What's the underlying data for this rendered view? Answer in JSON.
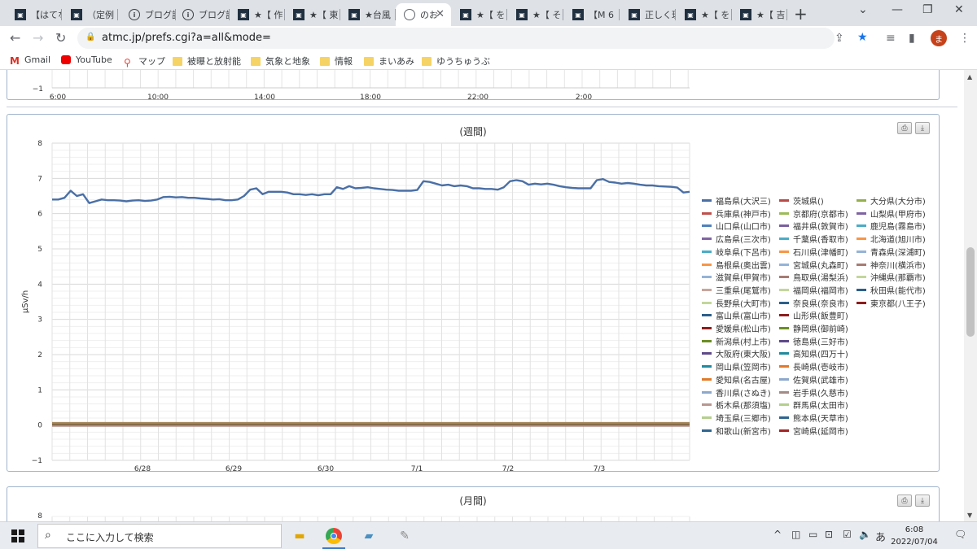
{
  "browser": {
    "tabs": [
      {
        "label": "【はてな",
        "icon": "dark-square-icon"
      },
      {
        "label": "（定例",
        "icon": "dark-square-icon"
      },
      {
        "label": "ブログ記",
        "icon": "info-icon"
      },
      {
        "label": "ブログ記",
        "icon": "info-icon"
      },
      {
        "label": "★【 作",
        "icon": "dark-square-icon"
      },
      {
        "label": "★【 東",
        "icon": "dark-square-icon"
      },
      {
        "label": "★台風",
        "icon": "dark-square-icon"
      },
      {
        "label": "のお",
        "icon": "globe-icon",
        "active": true
      },
      {
        "label": "★【 を",
        "icon": "dark-square-icon"
      },
      {
        "label": "★【 そ",
        "icon": "dark-square-icon"
      },
      {
        "label": "【M 6",
        "icon": "dark-square-icon"
      },
      {
        "label": "正しく理",
        "icon": "dark-square-icon"
      },
      {
        "label": "★【 を",
        "icon": "dark-square-icon"
      },
      {
        "label": "★【 吉",
        "icon": "dark-square-icon"
      }
    ],
    "url": "atmc.jp/prefs.cgi?a=all&mode=",
    "profile_initial": "ま",
    "bookmarks": [
      {
        "label": "Gmail",
        "icon": "gmail-icon"
      },
      {
        "label": "YouTube",
        "icon": "youtube-icon"
      },
      {
        "label": "マップ",
        "icon": "maps-icon"
      },
      {
        "label": "被曝と放射能",
        "icon": "folder-icon"
      },
      {
        "label": "気象と地象",
        "icon": "folder-icon"
      },
      {
        "label": "情報",
        "icon": "folder-icon"
      },
      {
        "label": "まいあみ",
        "icon": "folder-icon"
      },
      {
        "label": "ゆうちゅうぶ",
        "icon": "folder-icon"
      }
    ]
  },
  "top_chart": {
    "x_ticks": [
      "6:00",
      "10:00",
      "14:00",
      "18:00",
      "22:00",
      "2:00"
    ],
    "y_min_label": "−1"
  },
  "chart_data": [
    {
      "type": "line",
      "title": "(週間)",
      "ylabel": "μSv/h",
      "ylim": [
        -1,
        8
      ],
      "y_ticks": [
        "8",
        "7",
        "6",
        "5",
        "4",
        "3",
        "2",
        "1",
        "0",
        "−1"
      ],
      "x_ticks": [
        "6/28",
        "6/29",
        "6/30",
        "7/1",
        "7/2",
        "7/3"
      ],
      "grid": true,
      "legend_position": "right",
      "series": [
        {
          "name": "福島県(大沢三)",
          "color": "#4a6fa5",
          "values": [
            6.4,
            6.4,
            6.45,
            6.65,
            6.5,
            6.55,
            6.3,
            6.35,
            6.4,
            6.38,
            6.38,
            6.37,
            6.35,
            6.37,
            6.38,
            6.36,
            6.37,
            6.4,
            6.47,
            6.48,
            6.46,
            6.47,
            6.45,
            6.45,
            6.43,
            6.42,
            6.4,
            6.41,
            6.38,
            6.38,
            6.4,
            6.5,
            6.68,
            6.72,
            6.55,
            6.62,
            6.62,
            6.62,
            6.6,
            6.55,
            6.55,
            6.53,
            6.55,
            6.52,
            6.55,
            6.55,
            6.75,
            6.7,
            6.78,
            6.72,
            6.73,
            6.75,
            6.72,
            6.7,
            6.68,
            6.67,
            6.65,
            6.65,
            6.65,
            6.67,
            6.92,
            6.9,
            6.85,
            6.8,
            6.82,
            6.78,
            6.8,
            6.78,
            6.72,
            6.72,
            6.7,
            6.7,
            6.68,
            6.75,
            6.92,
            6.95,
            6.92,
            6.82,
            6.85,
            6.83,
            6.85,
            6.82,
            6.78,
            6.75,
            6.73,
            6.72,
            6.72,
            6.72,
            6.95,
            6.98,
            6.9,
            6.88,
            6.85,
            6.87,
            6.85,
            6.82,
            6.8,
            6.8,
            6.78,
            6.77,
            6.76,
            6.74,
            6.6,
            6.62
          ]
        },
        {
          "name": "茨城県()",
          "color": "#b94a48",
          "values": []
        },
        {
          "name": "大分県(大分市)",
          "color": "#93b04a",
          "values": []
        },
        {
          "name": "兵庫県(神戸市)",
          "color": "#c0504d",
          "values": []
        },
        {
          "name": "京都府(京都市)",
          "color": "#9bbb59",
          "values": []
        },
        {
          "name": "山梨県(甲府市)",
          "color": "#8064a2",
          "values": []
        },
        {
          "name": "山口県(山口市)",
          "color": "#4f81bd",
          "values": []
        },
        {
          "name": "福井県(敦賀市)",
          "color": "#7b5fa0",
          "values": []
        },
        {
          "name": "鹿児島(霧島市)",
          "color": "#4bacc6",
          "values": []
        },
        {
          "name": "広島県(三次市)",
          "color": "#8064a2",
          "values": []
        },
        {
          "name": "千葉県(香取市)",
          "color": "#4bacc6",
          "values": []
        },
        {
          "name": "北海道(旭川市)",
          "color": "#f79646",
          "values": []
        },
        {
          "name": "岐阜県(下呂市)",
          "color": "#4bacc6",
          "values": []
        },
        {
          "name": "石川県(津幡町)",
          "color": "#f79646",
          "values": []
        },
        {
          "name": "青森県(深浦町)",
          "color": "#95b3d7",
          "values": []
        },
        {
          "name": "島根県(奥出雲)",
          "color": "#f79646",
          "values": []
        },
        {
          "name": "宮城県(丸森町)",
          "color": "#95b3d7",
          "values": []
        },
        {
          "name": "神奈川(横浜市)",
          "color": "#a67c73",
          "values": []
        },
        {
          "name": "滋賀県(甲賀市)",
          "color": "#95b3d7",
          "values": []
        },
        {
          "name": "鳥取県(湯梨浜)",
          "color": "#a67c73",
          "values": []
        },
        {
          "name": "沖縄県(那覇市)",
          "color": "#c3d69b",
          "values": []
        },
        {
          "name": "三重県(尾鷲市)",
          "color": "#c9a59c",
          "values": []
        },
        {
          "name": "福岡県(福岡市)",
          "color": "#c3d69b",
          "values": []
        },
        {
          "name": "秋田県(能代市)",
          "color": "#2c5f8a",
          "values": []
        },
        {
          "name": "長野県(大町市)",
          "color": "#c3d69b",
          "values": []
        },
        {
          "name": "奈良県(奈良市)",
          "color": "#2c5f8a",
          "values": []
        },
        {
          "name": "東京都(八王子)",
          "color": "#8c1d1d",
          "values": []
        },
        {
          "name": "富山県(富山市)",
          "color": "#2c5f8a",
          "values": []
        },
        {
          "name": "山形県(飯豊町)",
          "color": "#8c1d1d",
          "values": []
        },
        {
          "name": "愛媛県(松山市)",
          "color": "#8c1d1d",
          "values": []
        },
        {
          "name": "静岡県(御前崎)",
          "color": "#6b8e23",
          "values": []
        },
        {
          "name": "新潟県(村上市)",
          "color": "#6b8e23",
          "values": []
        },
        {
          "name": "徳島県(三好市)",
          "color": "#5e4a8a",
          "values": []
        },
        {
          "name": "大阪府(東大阪)",
          "color": "#5e4a8a",
          "values": []
        },
        {
          "name": "高知県(四万十)",
          "color": "#1f8aa0",
          "values": []
        },
        {
          "name": "岡山県(笠岡市)",
          "color": "#1f8aa0",
          "values": []
        },
        {
          "name": "長崎県(壱岐市)",
          "color": "#e07b2a",
          "values": []
        },
        {
          "name": "愛知県(名古屋)",
          "color": "#e07b2a",
          "values": []
        },
        {
          "name": "佐賀県(武雄市)",
          "color": "#8ea8cc",
          "values": []
        },
        {
          "name": "香川県(さぬき)",
          "color": "#8ea8cc",
          "values": []
        },
        {
          "name": "岩手県(久慈市)",
          "color": "#a38b86",
          "values": []
        },
        {
          "name": "栃木県(那須塩)",
          "color": "#b8978f",
          "values": []
        },
        {
          "name": "群馬県(太田市)",
          "color": "#b5cf8e",
          "values": []
        },
        {
          "name": "埼玉県(三郷市)",
          "color": "#b5cf8e",
          "values": []
        },
        {
          "name": "熊本県(天草市)",
          "color": "#2f6690",
          "values": []
        },
        {
          "name": "和歌山(新宮市)",
          "color": "#2f6690",
          "values": []
        },
        {
          "name": "宮崎県(延岡市)",
          "color": "#a32424",
          "values": []
        }
      ],
      "baseline_note_value": 0.05
    },
    {
      "type": "line",
      "title": "(月間)",
      "y_ticks_visible": [
        "8"
      ]
    }
  ],
  "taskbar": {
    "search_placeholder": "ここに入力して検索",
    "time": "6:08",
    "date": "2022/07/04",
    "ime": "あ"
  }
}
